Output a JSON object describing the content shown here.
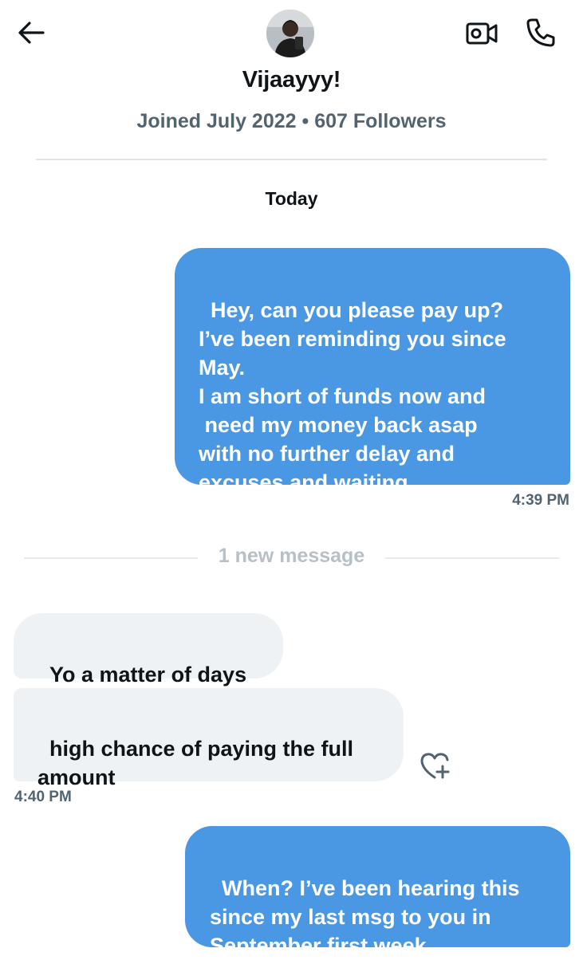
{
  "header": {
    "name": "Vijaayyy!",
    "meta": "Joined July 2022 • 607 Followers"
  },
  "icons": {
    "back": "back-arrow-icon",
    "video": "video-call-icon",
    "phone": "phone-call-icon",
    "reaction": "add-reaction-heart-icon"
  },
  "colors": {
    "sent_bubble": "#4a97e4",
    "received_bubble": "#eff2f4",
    "secondary_text": "#536471"
  },
  "conversation": {
    "date_label": "Today",
    "new_messages_label": "1 new message",
    "messages": [
      {
        "direction": "sent",
        "text": "Hey, can you please pay up?\nI’ve been reminding you since May.\nI am short of funds now and\n need my money back asap\nwith no further delay and\nexcuses and waiting",
        "time": "4:39 PM"
      },
      {
        "direction": "received",
        "text": "Yo a matter of days"
      },
      {
        "direction": "received",
        "text": "high chance of paying the full\namount",
        "time": "4:40 PM"
      },
      {
        "direction": "sent",
        "text": "When? I’ve been hearing this\nsince my last msg to you in\nSeptember first week"
      }
    ]
  }
}
